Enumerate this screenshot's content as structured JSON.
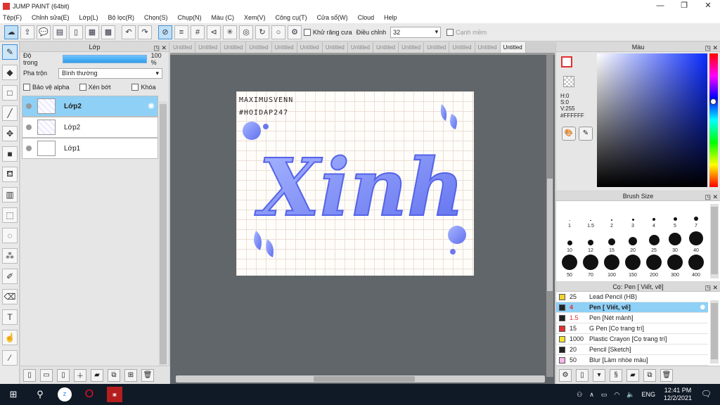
{
  "window": {
    "title": "JUMP PAINT (64bit)"
  },
  "menu": [
    "Tệp(F)",
    "Chỉnh sửa(E)",
    "Lớp(L)",
    "Bộ lọc(R)",
    "Chọn(S)",
    "Chụp(N)",
    "Màu (C)",
    "Xem(V)",
    "Công cụ(T)",
    "Cửa sổ(W)",
    "Cloud",
    "Help"
  ],
  "toolbar": {
    "antialias_label": "Khử răng cưa",
    "adjust_label": "Điều chỉnh",
    "adjust_value": "32",
    "smooth_label": "Cạnh mềm"
  },
  "layer_panel": {
    "title": "Lớp",
    "opacity_label": "Độ trong",
    "opacity_value": "100 %",
    "blend_label": "Pha trộn",
    "blend_value": "Bình thường",
    "protect_alpha": "Bảo vệ alpha",
    "clip": "Xén bớt",
    "lock": "Khóa",
    "layers": [
      "Lớp2",
      "Lớp2",
      "Lớp1"
    ]
  },
  "tabs": [
    "Untitled",
    "Untitled",
    "Untitled",
    "Untitled",
    "Untitled",
    "Untitled",
    "Untitled",
    "Untitled",
    "Untitled",
    "Untitled",
    "Untitled",
    "Untitled",
    "Untitled",
    "Untitled"
  ],
  "canvas": {
    "handle_line1": "MAXIMUSVENN",
    "handle_line2": "#HOIDAP247",
    "word": "Xinh"
  },
  "color_panel": {
    "title": "Màu",
    "h": "H:0",
    "s": "S:0",
    "v": "V:255",
    "hex": "#FFFFFF"
  },
  "brush_size": {
    "title": "Brush Size",
    "sizes": [
      "1",
      "1.5",
      "2",
      "3",
      "4",
      "5",
      "7",
      "10",
      "12",
      "15",
      "20",
      "25",
      "30",
      "40",
      "50",
      "70",
      "100",
      "150",
      "200",
      "300",
      "400"
    ]
  },
  "pen_panel": {
    "title": "Cọ: Pen [ Viết, vẽ]",
    "items": [
      {
        "size": "25",
        "name": "Lead Pencil (HB)",
        "color": "#f2d22e"
      },
      {
        "size": "4",
        "name": "Pen [ Viết, vẽ]",
        "color": "#222222"
      },
      {
        "size": "1.5",
        "name": "Pen [Nét mảnh]",
        "color": "#222222"
      },
      {
        "size": "15",
        "name": "G Pen [Cọ trang trí]",
        "color": "#e23030"
      },
      {
        "size": "1000",
        "name": "Plastic Crayon [Cọ trang trí]",
        "color": "#f2e12e"
      },
      {
        "size": "20",
        "name": "Pencil [Sketch]",
        "color": "#222222"
      },
      {
        "size": "50",
        "name": "Blur [Làm nhòe màu]",
        "color": "#f6b6e6"
      }
    ]
  },
  "taskbar": {
    "lang": "ENG",
    "time": "12:41 PM",
    "date": "12/2/2021"
  }
}
